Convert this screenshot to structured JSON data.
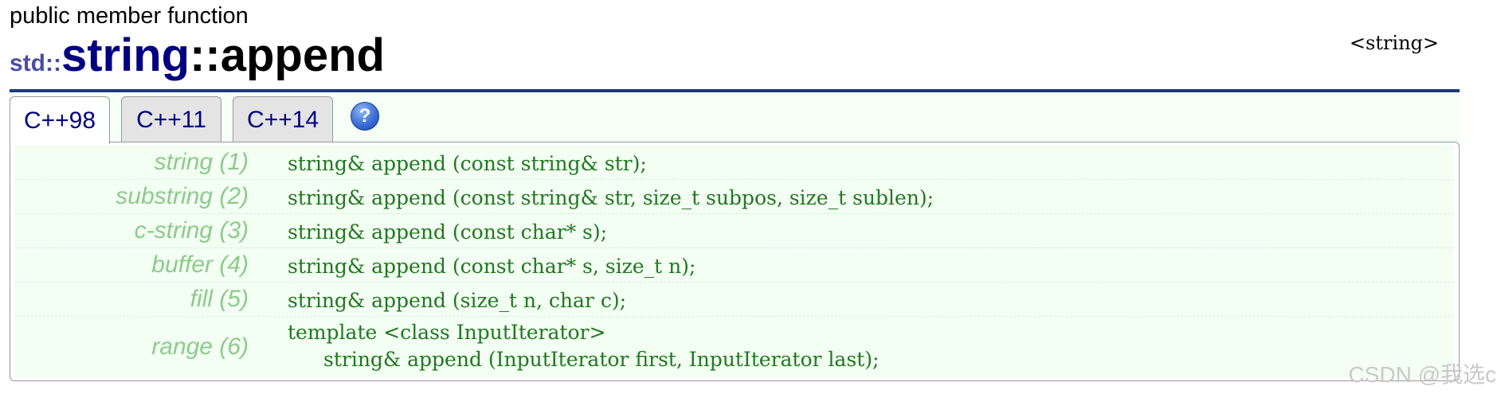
{
  "header": {
    "kind": "public member function",
    "namespace": "std::",
    "class_name": "string",
    "function": "::append",
    "header_file": "<string>"
  },
  "tabs": [
    {
      "label": "C++98",
      "active": true
    },
    {
      "label": "C++11",
      "active": false
    },
    {
      "label": "C++14",
      "active": false
    }
  ],
  "help_icon": {
    "glyph": "?",
    "icon": "help-icon"
  },
  "signatures": [
    {
      "label": "string (1)",
      "code": "string& append (const string& str);"
    },
    {
      "label": "substring (2)",
      "code": "string& append (const string& str, size_t subpos, size_t sublen);"
    },
    {
      "label": "c-string (3)",
      "code": "string& append (const char* s);"
    },
    {
      "label": "buffer (4)",
      "code": "string& append (const char* s, size_t n);"
    },
    {
      "label": "fill (5)",
      "code": "string& append (size_t n, char c);"
    },
    {
      "label": "range (6)",
      "code_line1": "template <class InputIterator>",
      "code_line2": "string& append (InputIterator first, InputIterator last);"
    }
  ],
  "watermark": "CSDN @我选c",
  "colors": {
    "title_rule": "#1a3a7a",
    "label_green": "#8fc98f",
    "code_green": "#227722",
    "row_bg": "#f2fff2",
    "class_name": "#000080"
  }
}
